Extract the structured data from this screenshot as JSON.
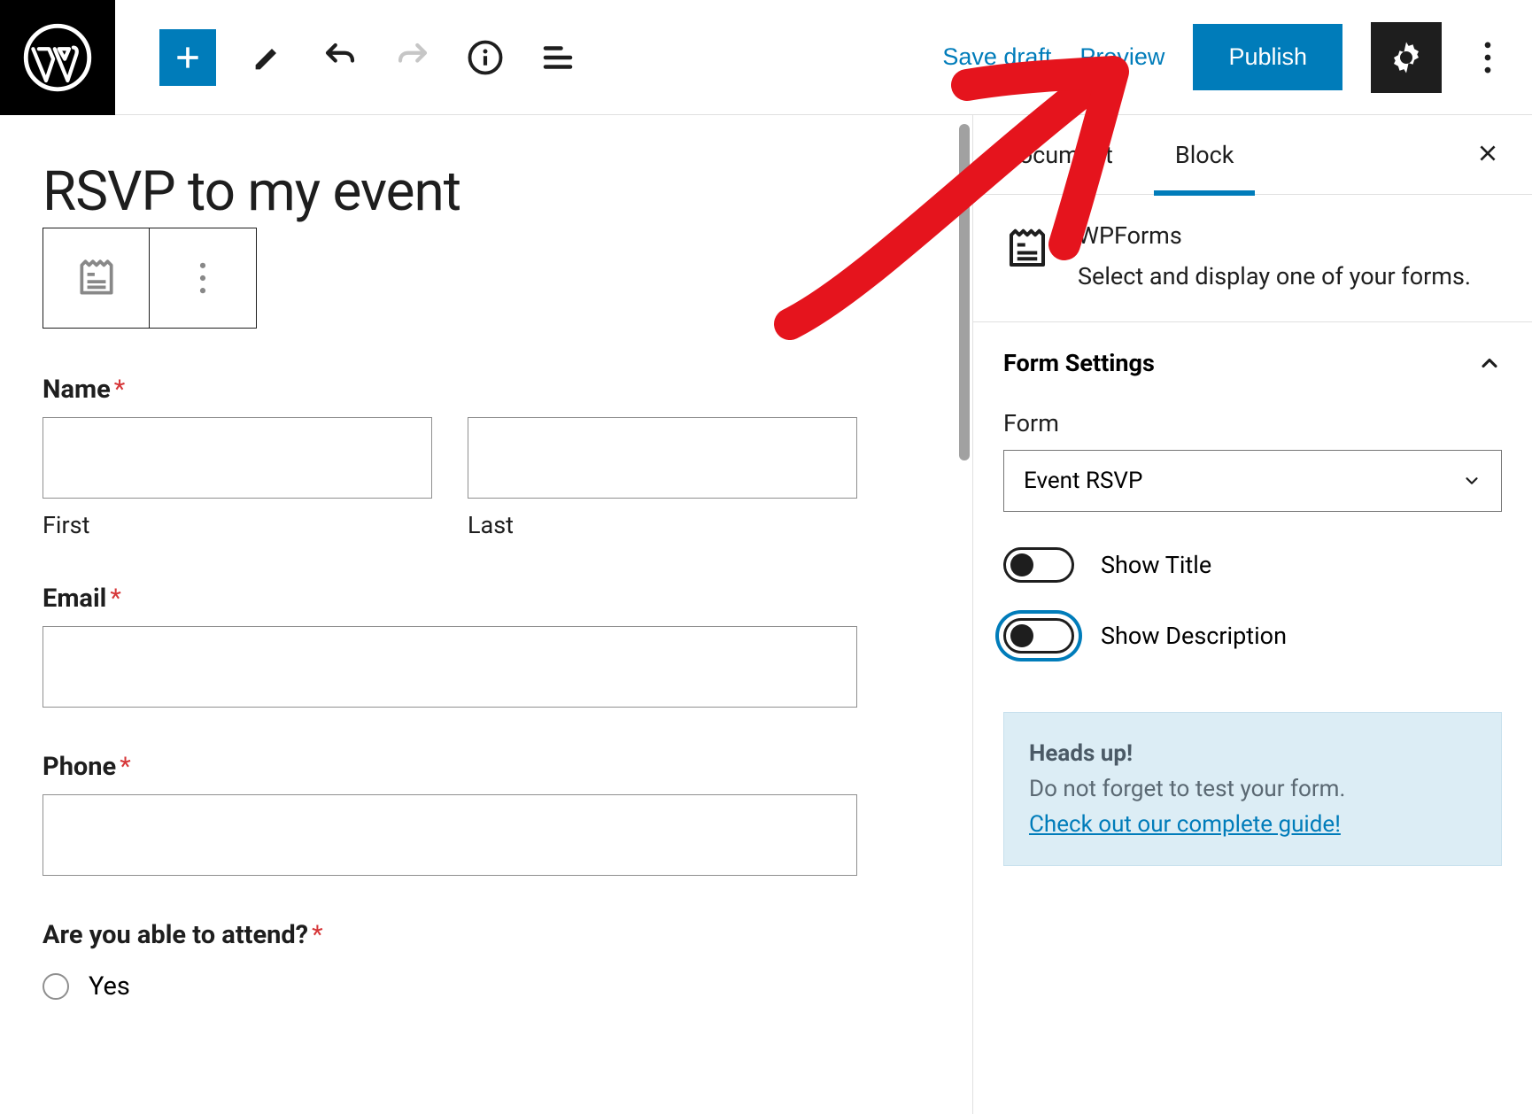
{
  "topbar": {
    "save_draft": "Save draft",
    "preview": "Preview",
    "publish": "Publish"
  },
  "editor": {
    "title": "RSVP to my event",
    "fields": {
      "name_label": "Name",
      "name_first_sub": "First",
      "name_last_sub": "Last",
      "email_label": "Email",
      "phone_label": "Phone",
      "attend_label": "Are you able to attend?",
      "attend_options": [
        "Yes"
      ]
    }
  },
  "sidebar": {
    "tabs": {
      "document": "Document",
      "block": "Block"
    },
    "block_info": {
      "title": "WPForms",
      "desc": "Select and display one of your forms."
    },
    "form_settings": {
      "heading": "Form Settings",
      "form_label": "Form",
      "form_selected": "Event RSVP",
      "show_title": "Show Title",
      "show_description": "Show Description"
    },
    "notice": {
      "heading": "Heads up!",
      "line": "Do not forget to test your form.",
      "link": "Check out our complete guide!"
    }
  }
}
